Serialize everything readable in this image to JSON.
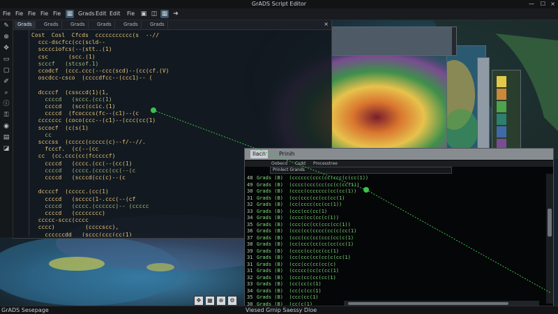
{
  "window": {
    "title": "GrADS Script Editor"
  },
  "menubar": {
    "items": [
      "Fie",
      "Fie",
      "Fie",
      "Fie",
      "Fie",
      "Grads",
      "Edit",
      "Edit",
      "Fie"
    ],
    "icons": [
      "grid-icon",
      "window-icon",
      "layers-icon",
      "arrow-right-icon"
    ]
  },
  "toolbar": {
    "tools": [
      "pencil-icon",
      "zoom-icon",
      "pan-icon",
      "file-icon",
      "file-icon",
      "brush-icon",
      "search-icon",
      "info-icon",
      "lock-icon",
      "eye-icon",
      "terminal-icon",
      "shade-icon"
    ]
  },
  "editor": {
    "tabs": [
      "Grads",
      "Grads",
      "Grads",
      "Grads",
      "Grads",
      "Grads"
    ],
    "close": "×",
    "lines": [
      "Cost  Cosl  Cfcds  ccccccccccc(s  --//",
      "  ccc-dscfcc(cc(scld--",
      "  scccciofcs(--(stt..(1)",
      "  csc      (scc.(1)",
      "  scccf   (stcsof.1)",
      "  ccodcf  (ccc.ccc(--ccc(scd)--(cc(cf.(V)",
      "  oscdcc-csco  (ccccdfcc--(ccc1)-- (",
      "",
      "  dccccf  (cssccd(1)(1,",
      "    ccccd   (sccc.(cc(1)",
      "    ccccd   (scc(ccic.(1)",
      "    ccccd  (fcocccs(fc--(c1)--(c",
      "  ccccccc (coco(ccc--(c1)--(ccc(cc(1)",
      "  sccocf  (c(s(1)",
      "    cc",
      "  scccss  (ccccc(ccccc(c)--f/--//.",
      "    fcccf.  (c(--(cc",
      "  cc  (cc.ccc(cc(fcccccf)",
      "    ccccd   (cccc.(cc(--(cc(1)",
      "    ccccd   (cccc.(cccc(cc(--(c",
      "    ccccd   (scccd(cc(c)--(c",
      "",
      "  dccccf  (ccccc.(cc(1)",
      "    ccccd   (scccc(1-.ccc(--(cf",
      "    ccccd   (cccc.(cccccc)-- (ccccc",
      "    ccccd   (cccccccc)",
      "  ccccc-sccc(cccc",
      "  cccc)         (ccccscc),",
      "    ccccccdd   (sccc(ccc(cc(1)",
      "  cccf   (cccc(ccc.(cc(--(1)"
    ]
  },
  "console": {
    "tabs": [
      "Ilacn",
      "Prinih"
    ],
    "subtabs": [
      "Oobecd",
      "Csdd",
      "Processtree"
    ],
    "search_value": "Prinlect Grands",
    "lines": [
      {
        "n": "48",
        "t": "Grads (B)  (cccccc(ccc(cc(ccc(c(cc(1))"
      },
      {
        "n": "49",
        "t": "Grads (B)  (cccc(ccc(cc(cc(c(cc(1))"
      },
      {
        "n": "30",
        "t": "Grads (B)  (cccc(ccccccc(cc(cc(1))"
      },
      {
        "n": "31",
        "t": "Grads (B)  (cc(ccc(cc(cc(cc(1)"
      },
      {
        "n": "32",
        "t": "Grads (B)  (cc(cccc(cc(cc(1))"
      },
      {
        "n": "33",
        "t": "Grads (B)  (ccc(cc(cc(1)"
      },
      {
        "n": "34",
        "t": "Grads (B)  (cccc(cc(cc(c(1))"
      },
      {
        "n": "35",
        "t": "Grads (B)  (ccc(cc(cc(ccc(cc(1))"
      },
      {
        "n": "36",
        "t": "Grads (B)  (ccc(cc(cccc(cc(c(cc(1)"
      },
      {
        "n": "37",
        "t": "Grads (B)  (ccc(cc(cc(ccc(cc(c(1)"
      },
      {
        "n": "38",
        "t": "Grads (B)  (cc(ccc(cc(cc(cc(cc(1)"
      },
      {
        "n": "39",
        "t": "Grads (B)  (cccc(cc(cc(cc(1)"
      },
      {
        "n": "31",
        "t": "Grads (B)  (cc(ccc(cc(cc(c(cc(1)"
      },
      {
        "n": "31",
        "t": "Grads (B)  (ccc(cc(cc(cc(c)"
      },
      {
        "n": "31",
        "t": "Grads (B)  (ccccc(cc(c(cc(1)"
      },
      {
        "n": "32",
        "t": "Grads (B)  (ccc(cc(cc(cc(1)"
      },
      {
        "n": "33",
        "t": "Grads (B)  (cc(cc(c(1)"
      },
      {
        "n": "34",
        "t": "Grads (B)  (cc(c(cc(1)"
      },
      {
        "n": "35",
        "t": "Grads (B)  (ccc(cc(1)"
      },
      {
        "n": "30",
        "t": "Grads (B)  (cc(c(1)"
      }
    ]
  },
  "status": {
    "left": "GrADS Sesepage",
    "center": "Viesed Grnip Saessy Dloe"
  },
  "colors": {
    "accent_green": "#39c34a",
    "code_orange": "#e9c47a",
    "console_green": "#7fdc7a"
  }
}
